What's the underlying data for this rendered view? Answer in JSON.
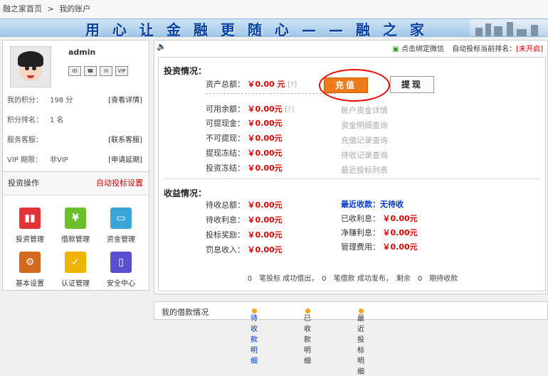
{
  "breadcrumb": {
    "home": "融之家首页",
    "sep": ">",
    "current": "我的账户"
  },
  "banner": {
    "slogan": "用心让金融更随心——融之家"
  },
  "profile": {
    "username": "admin",
    "badges": [
      "id",
      "phone",
      "email",
      "VIP"
    ],
    "points_label": "我的积分：",
    "points_value": "198 分",
    "points_link": "[查看详情]",
    "rank_label": "积分排名：",
    "rank_value": "1 名",
    "service_label": "服务客服：",
    "service_link": "[联系客服]",
    "vip_label": "VIP 期限：",
    "vip_value": "非VIP",
    "vip_link": "[申请延期]"
  },
  "operations": {
    "title": "投资操作",
    "auto_bid": "自动投标设置",
    "items": [
      {
        "label": "投资管理",
        "icon": "chart-icon",
        "color": "#e0333a"
      },
      {
        "label": "借款管理",
        "icon": "money-bag-icon",
        "color": "#6cbf2a"
      },
      {
        "label": "资金管理",
        "icon": "card-icon",
        "color": "#3aa6d8"
      },
      {
        "label": "基本设置",
        "icon": "gear-icon",
        "color": "#d2691e"
      },
      {
        "label": "认证管理",
        "icon": "check-icon",
        "color": "#f0b400"
      },
      {
        "label": "安全中心",
        "icon": "usb-icon",
        "color": "#5a4fcf"
      }
    ]
  },
  "topbar": {
    "wechat": "点击绑定微信",
    "rank_text": "自动投标当前排名：",
    "rank_value": "[未开启]"
  },
  "investment": {
    "title": "投资情况：",
    "total_label": "资产总额：",
    "total_value": "￥0.00 元",
    "help": "[?]",
    "charge": "充值",
    "withdraw": "提现",
    "rows": [
      {
        "label": "可用余额：",
        "value": "￥0.00元",
        "help": "[?]",
        "link": "账户资金详情"
      },
      {
        "label": "可提现金：",
        "value": "￥0.00元",
        "help": "",
        "link": "资金明细查询"
      },
      {
        "label": "不可提现：",
        "value": "￥0.00元",
        "help": "",
        "link": "充值记录查询"
      },
      {
        "label": "提现冻结：",
        "value": "￥0.00元",
        "help": "",
        "link": "待收记录查询"
      },
      {
        "label": "投资冻结：",
        "value": "￥0.00元",
        "help": "",
        "link": "最近投标列表"
      }
    ]
  },
  "income": {
    "title": "收益情况：",
    "left": [
      {
        "label": "待收总额：",
        "value": "￥0.00元"
      },
      {
        "label": "待收利息：",
        "value": "￥0.00元"
      },
      {
        "label": "投标奖励：",
        "value": "￥0.00元"
      },
      {
        "label": "罚息收入：",
        "value": "￥0.00元"
      }
    ],
    "recent_label": "最近收款：",
    "recent_value": "无待收",
    "right": [
      {
        "label": "已收利息：",
        "value": "￥0.00元"
      },
      {
        "label": "净赚利息：",
        "value": "￥0.00元"
      },
      {
        "label": "管理费用：",
        "value": "￥0.00元"
      }
    ]
  },
  "summary": "0　笔投标 成功借出，　0　笔借款 成功发布，　剩余　0　期待收款",
  "loans": {
    "title": "我的借款情况",
    "tab1": "待收款明细",
    "tab2": "已收款明细",
    "tab3": "最近投标明细"
  }
}
